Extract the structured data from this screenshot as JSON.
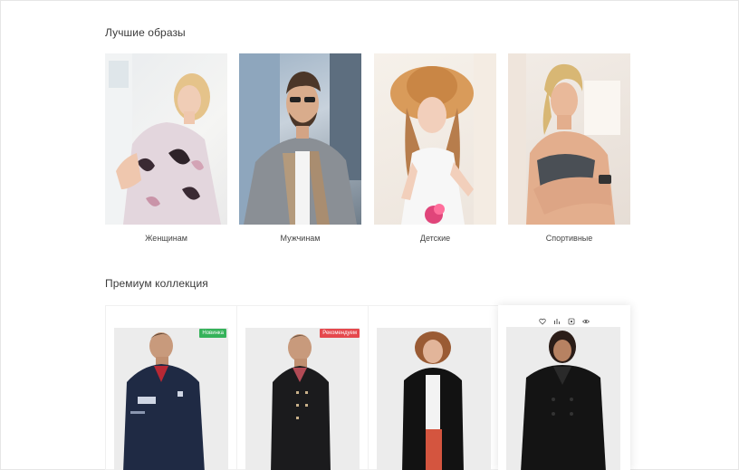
{
  "sections": {
    "best_looks_title": "Лучшие образы",
    "premium_title": "Премиум коллекция"
  },
  "looks": [
    {
      "label": "Женщинам"
    },
    {
      "label": "Мужчинам"
    },
    {
      "label": "Детские"
    },
    {
      "label": "Спортивные"
    }
  ],
  "products": [
    {
      "badge": "Новинка"
    },
    {
      "badge": "Рекомендуем"
    },
    {
      "badge": ""
    },
    {
      "badge": ""
    }
  ],
  "colors": {
    "badge_new": "#35b25a",
    "badge_recommend": "#e5484d"
  },
  "icons": [
    "heart-icon",
    "compare-icon",
    "cart-icon",
    "eye-icon"
  ]
}
